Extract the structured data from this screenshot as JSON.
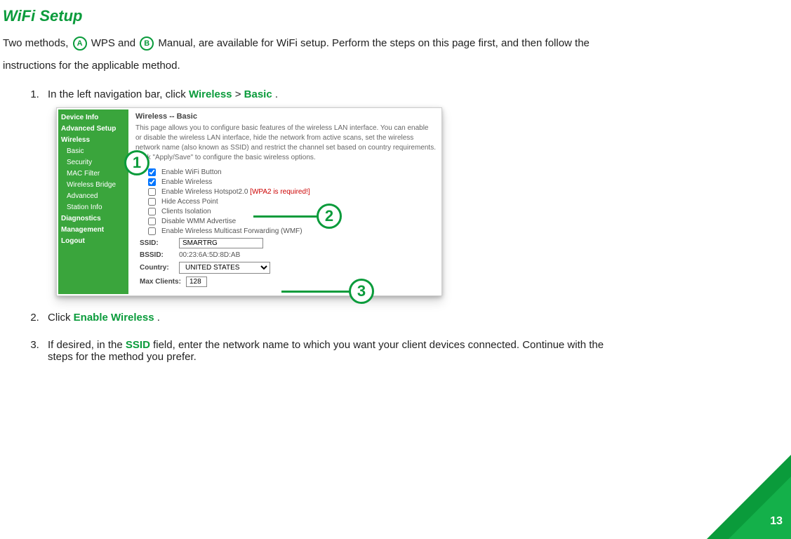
{
  "title": "WiFi Setup",
  "intro": {
    "before_a": "Two methods, ",
    "a": "A",
    "mid1": " WPS and ",
    "b": "B",
    "mid2": " Manual, are available for WiFi setup. Perform the steps on this page first, and then follow the",
    "line2": "instructions for the applicable method."
  },
  "step1": {
    "pre": "In the left navigation bar, click ",
    "wireless": "Wireless",
    "gt": " > ",
    "basic": "Basic",
    "post": "."
  },
  "step2": {
    "pre": "Click ",
    "link": "Enable Wireless",
    "post": "."
  },
  "step3": {
    "pre": "If desired, in the ",
    "ssid": "SSID",
    "post": " field, enter the network name to which you want your client devices connected. Continue with the",
    "line2": "steps for the method you prefer."
  },
  "shot": {
    "sidebar": {
      "items": [
        {
          "label": "Device Info",
          "cls": "top"
        },
        {
          "label": "Advanced Setup",
          "cls": "top"
        },
        {
          "label": "Wireless",
          "cls": "top"
        },
        {
          "label": "Basic",
          "cls": "sub"
        },
        {
          "label": "Security",
          "cls": "sub"
        },
        {
          "label": "MAC Filter",
          "cls": "sub"
        },
        {
          "label": "Wireless Bridge",
          "cls": "sub"
        },
        {
          "label": "Advanced",
          "cls": "sub"
        },
        {
          "label": "Station Info",
          "cls": "sub"
        },
        {
          "label": "Diagnostics",
          "cls": "top"
        },
        {
          "label": "Management",
          "cls": "top"
        },
        {
          "label": "Logout",
          "cls": "top"
        }
      ]
    },
    "header": "Wireless -- Basic",
    "desc": "This page allows you to configure basic features of the wireless LAN interface. You can enable or disable the wireless LAN interface, hide the network from active scans, set the wireless network name (also known as SSID) and restrict the channel set based on country requirements. Click \"Apply/Save\" to configure the basic wireless options.",
    "options": [
      {
        "label": "Enable WiFi Button",
        "checked": true,
        "hot": ""
      },
      {
        "label": "Enable Wireless",
        "checked": true,
        "hot": ""
      },
      {
        "label": "Enable Wireless Hotspot2.0 [WPA2 is required!]",
        "checked": false,
        "hot": "red"
      },
      {
        "label": "Hide Access Point",
        "checked": false,
        "hot": ""
      },
      {
        "label": "Clients Isolation",
        "checked": false,
        "hot": ""
      },
      {
        "label": "Disable WMM Advertise",
        "checked": false,
        "hot": ""
      },
      {
        "label": "Enable Wireless Multicast Forwarding (WMF)",
        "checked": false,
        "hot": ""
      }
    ],
    "fields": {
      "ssid_lbl": "SSID:",
      "ssid_val": "SMARTRG",
      "bssid_lbl": "BSSID:",
      "bssid_val": "00:23:6A:5D:8D:AB",
      "country_lbl": "Country:",
      "country_val": "UNITED STATES",
      "max_lbl": "Max Clients:",
      "max_val": "128"
    },
    "callouts": {
      "c1": "1",
      "c2": "2",
      "c3": "3"
    }
  },
  "pagenum": "13"
}
